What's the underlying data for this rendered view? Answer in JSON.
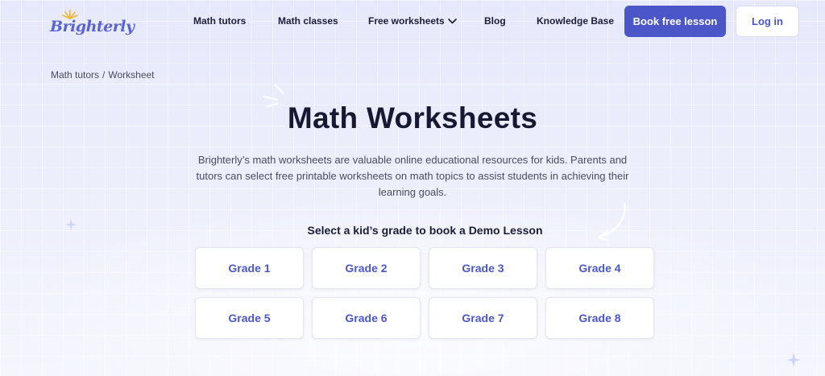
{
  "logo": {
    "text": "Brighterly"
  },
  "nav": {
    "items": [
      {
        "label": "Math tutors"
      },
      {
        "label": "Math classes"
      },
      {
        "label": "Free worksheets"
      },
      {
        "label": "Blog"
      },
      {
        "label": "Knowledge Base"
      }
    ],
    "book_label": "Book free lesson",
    "login_label": "Log in"
  },
  "breadcrumb": {
    "home": "Math tutors",
    "separator": "/",
    "current": "Worksheet"
  },
  "hero": {
    "title": "Math Worksheets",
    "description": "Brighterly’s math worksheets are valuable online educational resources for kids. Parents and tutors can select free printable worksheets on math topics to assist students in achieving their learning goals.",
    "subtitle": "Select a kid’s grade to book a Demo Lesson"
  },
  "grades": [
    "Grade 1",
    "Grade 2",
    "Grade 3",
    "Grade 4",
    "Grade 5",
    "Grade 6",
    "Grade 7",
    "Grade 8"
  ],
  "colors": {
    "accent": "#4b57c9",
    "logo": "#5a63d4",
    "sun": "#f2b630",
    "text": "#1b1d3a"
  },
  "icons": {
    "dropdown": "chevron-down-icon",
    "decor": [
      "sparkle-lines-icon",
      "curved-arrow-icon",
      "star-icon"
    ]
  }
}
